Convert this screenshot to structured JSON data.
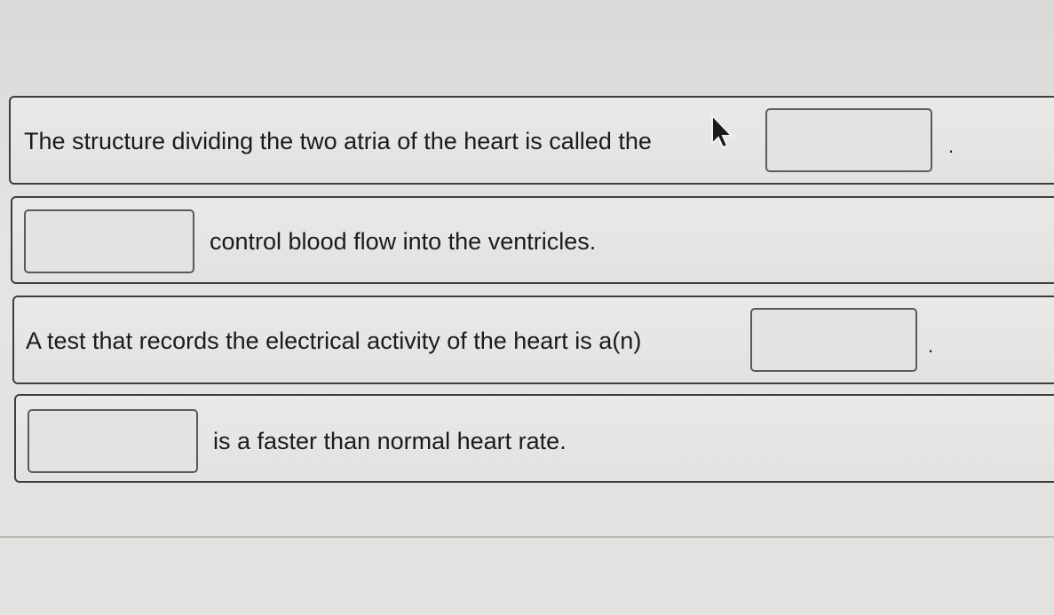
{
  "questions": [
    {
      "text": "The structure dividing the two atria of the heart is called the",
      "suffix": "."
    },
    {
      "text": "control blood flow into the ventricles.",
      "suffix": ""
    },
    {
      "text": "A test that records the electrical activity of the heart is a(n)",
      "suffix": "."
    },
    {
      "text": "is a faster than normal heart rate.",
      "suffix": ""
    }
  ]
}
